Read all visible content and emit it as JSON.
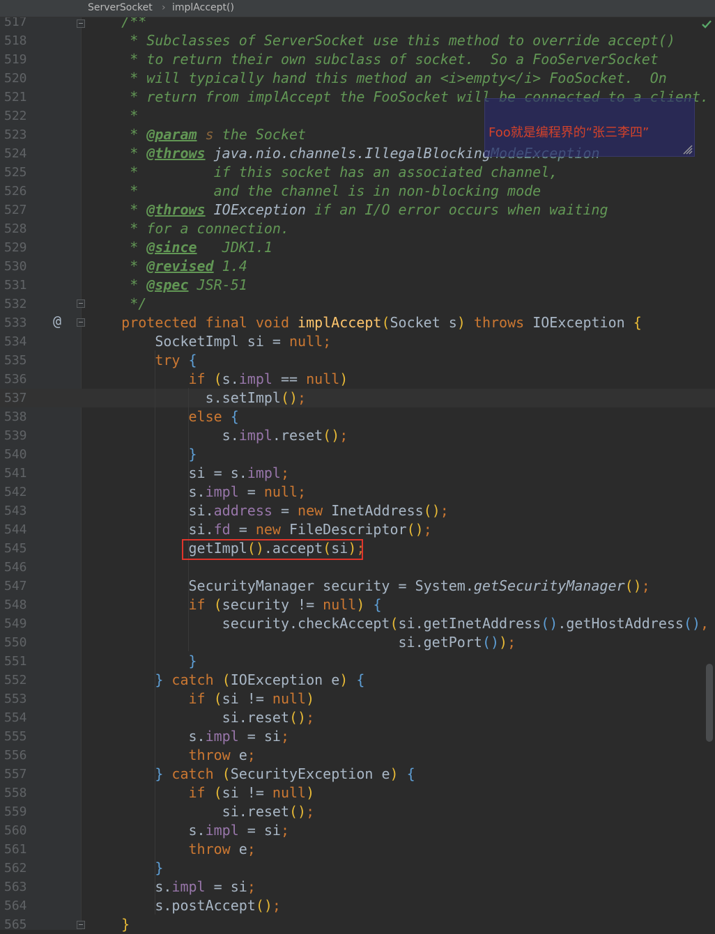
{
  "breadcrumb": {
    "class_name": "ServerSocket",
    "method_name": "implAccept()"
  },
  "note": {
    "text": "Foo就是编程界的“张三李四”"
  },
  "status": {
    "check": "check-icon"
  },
  "lines": [
    {
      "number": "517",
      "segments": [
        [
          "t-doc",
          "    /**"
        ]
      ]
    },
    {
      "number": "518",
      "segments": [
        [
          "t-doc",
          "     * Subclasses of ServerSocket use this method to override accept()"
        ]
      ]
    },
    {
      "number": "519",
      "segments": [
        [
          "t-doc",
          "     * to return their own subclass of socket.  So a FooServerSocket"
        ]
      ]
    },
    {
      "number": "520",
      "segments": [
        [
          "t-doc",
          "     * will typically hand this method an <i>empty</i> FooSocket.  On"
        ]
      ]
    },
    {
      "number": "521",
      "segments": [
        [
          "t-doc",
          "     * return from implAccept the FooSocket will be connected to a client."
        ]
      ]
    },
    {
      "number": "522",
      "segments": [
        [
          "t-doc",
          "     *"
        ]
      ]
    },
    {
      "number": "523",
      "segments": [
        [
          "t-doc",
          "     * "
        ],
        [
          "t-doctag",
          "@param"
        ],
        [
          "t-doc",
          " "
        ],
        [
          "t-docval",
          "s"
        ],
        [
          "t-doc",
          " the Socket"
        ]
      ]
    },
    {
      "number": "524",
      "segments": [
        [
          "t-doc",
          "     * "
        ],
        [
          "t-doctag",
          "@throws"
        ],
        [
          "t-doc",
          " "
        ],
        [
          "t-docref",
          "java.nio.channels.IllegalBlocking"
        ],
        [
          "t-dim",
          "ModeException"
        ]
      ]
    },
    {
      "number": "525",
      "segments": [
        [
          "t-doc",
          "     *         if this socket has an associated channel,"
        ]
      ]
    },
    {
      "number": "526",
      "segments": [
        [
          "t-doc",
          "     *         and the channel is in non-blocking mode"
        ]
      ]
    },
    {
      "number": "527",
      "segments": [
        [
          "t-doc",
          "     * "
        ],
        [
          "t-doctag",
          "@throws"
        ],
        [
          "t-doc",
          " "
        ],
        [
          "t-docref",
          "IOException"
        ],
        [
          "t-doc",
          " if an I/O error occurs when waiting"
        ]
      ]
    },
    {
      "number": "528",
      "segments": [
        [
          "t-doc",
          "     * for a connection."
        ]
      ]
    },
    {
      "number": "529",
      "segments": [
        [
          "t-doc",
          "     * "
        ],
        [
          "t-doctag",
          "@since"
        ],
        [
          "t-doc",
          "   JDK1.1"
        ]
      ]
    },
    {
      "number": "530",
      "segments": [
        [
          "t-doc",
          "     * "
        ],
        [
          "t-doctag",
          "@revised"
        ],
        [
          "t-doc",
          " 1.4"
        ]
      ]
    },
    {
      "number": "531",
      "segments": [
        [
          "t-doc",
          "     * "
        ],
        [
          "t-doctag",
          "@spec"
        ],
        [
          "t-doc",
          " JSR-51"
        ]
      ]
    },
    {
      "number": "532",
      "segments": [
        [
          "t-doc",
          "     */"
        ]
      ]
    },
    {
      "number": "533",
      "segments": [
        [
          "t-kw",
          "    protected final void "
        ],
        [
          "t-fn",
          "implAccept"
        ],
        [
          "t-p1",
          "("
        ],
        [
          "t-plain",
          "Socket s"
        ],
        [
          "t-p1",
          ")"
        ],
        [
          "t-kw",
          " throws "
        ],
        [
          "t-plain",
          "IOException "
        ],
        [
          "t-p1",
          "{"
        ]
      ]
    },
    {
      "number": "534",
      "segments": [
        [
          "t-plain",
          "        SocketImpl si = "
        ],
        [
          "t-kw",
          "null"
        ],
        [
          "t-kw",
          ";"
        ]
      ]
    },
    {
      "number": "535",
      "segments": [
        [
          "t-kw",
          "        try "
        ],
        [
          "t-p2",
          "{"
        ]
      ]
    },
    {
      "number": "536",
      "segments": [
        [
          "t-kw",
          "            if "
        ],
        [
          "t-p1",
          "("
        ],
        [
          "t-plain",
          "s."
        ],
        [
          "t-field",
          "impl"
        ],
        [
          "t-plain",
          " == "
        ],
        [
          "t-kw",
          "null"
        ],
        [
          "t-p1",
          ")"
        ]
      ]
    },
    {
      "number": "537",
      "segments": [
        [
          "t-plain",
          "              s.setImpl"
        ],
        [
          "t-p1",
          "()"
        ],
        [
          "t-kw",
          ";"
        ]
      ]
    },
    {
      "number": "538",
      "segments": [
        [
          "t-kw",
          "            else "
        ],
        [
          "t-p2",
          "{"
        ]
      ]
    },
    {
      "number": "539",
      "segments": [
        [
          "t-plain",
          "                s."
        ],
        [
          "t-field",
          "impl"
        ],
        [
          "t-plain",
          ".reset"
        ],
        [
          "t-p1",
          "()"
        ],
        [
          "t-kw",
          ";"
        ]
      ]
    },
    {
      "number": "540",
      "segments": [
        [
          "t-p2",
          "            }"
        ]
      ]
    },
    {
      "number": "541",
      "segments": [
        [
          "t-plain",
          "            si = s."
        ],
        [
          "t-field",
          "impl"
        ],
        [
          "t-kw",
          ";"
        ]
      ]
    },
    {
      "number": "542",
      "segments": [
        [
          "t-plain",
          "            s."
        ],
        [
          "t-field",
          "impl"
        ],
        [
          "t-plain",
          " = "
        ],
        [
          "t-kw",
          "null;"
        ]
      ]
    },
    {
      "number": "543",
      "segments": [
        [
          "t-plain",
          "            si."
        ],
        [
          "t-field",
          "address"
        ],
        [
          "t-plain",
          " = "
        ],
        [
          "t-kw",
          "new "
        ],
        [
          "t-plain",
          "InetAddress"
        ],
        [
          "t-p1",
          "()"
        ],
        [
          "t-kw",
          ";"
        ]
      ]
    },
    {
      "number": "544",
      "segments": [
        [
          "t-plain",
          "            si."
        ],
        [
          "t-field",
          "fd"
        ],
        [
          "t-plain",
          " = "
        ],
        [
          "t-kw",
          "new "
        ],
        [
          "t-plain",
          "FileDescriptor"
        ],
        [
          "t-p1",
          "()"
        ],
        [
          "t-kw",
          ";"
        ]
      ]
    },
    {
      "number": "545",
      "segments": [
        [
          "t-plain",
          "            getImpl"
        ],
        [
          "t-p1",
          "()"
        ],
        [
          "t-plain",
          ".accept"
        ],
        [
          "t-p1",
          "("
        ],
        [
          "t-plain",
          "si"
        ],
        [
          "t-p1",
          ")"
        ],
        [
          "t-kw",
          ";"
        ]
      ]
    },
    {
      "number": "546",
      "segments": [
        [
          "t-plain",
          ""
        ]
      ]
    },
    {
      "number": "547",
      "segments": [
        [
          "t-plain",
          "            SecurityManager security = System."
        ],
        [
          "t-static",
          "getSecurityManager"
        ],
        [
          "t-p1",
          "()"
        ],
        [
          "t-kw",
          ";"
        ]
      ]
    },
    {
      "number": "548",
      "segments": [
        [
          "t-kw",
          "            if "
        ],
        [
          "t-p1",
          "("
        ],
        [
          "t-plain",
          "security != "
        ],
        [
          "t-kw",
          "null"
        ],
        [
          "t-p1",
          ")"
        ],
        [
          "t-plain",
          " "
        ],
        [
          "t-p2",
          "{"
        ]
      ]
    },
    {
      "number": "549",
      "segments": [
        [
          "t-plain",
          "                security.checkAccept"
        ],
        [
          "t-p1",
          "("
        ],
        [
          "t-plain",
          "si.getInetAddress"
        ],
        [
          "t-p2",
          "()"
        ],
        [
          "t-plain",
          ".getHostAddress"
        ],
        [
          "t-p2",
          "()"
        ],
        [
          "t-kw",
          ","
        ]
      ]
    },
    {
      "number": "550",
      "segments": [
        [
          "t-plain",
          "                                     si.getPort"
        ],
        [
          "t-p2",
          "()"
        ],
        [
          "t-p1",
          ")"
        ],
        [
          "t-kw",
          ";"
        ]
      ]
    },
    {
      "number": "551",
      "segments": [
        [
          "t-p2",
          "            }"
        ]
      ]
    },
    {
      "number": "552",
      "segments": [
        [
          "t-p2",
          "        }"
        ],
        [
          "t-kw",
          " catch "
        ],
        [
          "t-p1",
          "("
        ],
        [
          "t-plain",
          "IOException e"
        ],
        [
          "t-p1",
          ")"
        ],
        [
          "t-plain",
          " "
        ],
        [
          "t-p2",
          "{"
        ]
      ]
    },
    {
      "number": "553",
      "segments": [
        [
          "t-kw",
          "            if "
        ],
        [
          "t-p1",
          "("
        ],
        [
          "t-plain",
          "si != "
        ],
        [
          "t-kw",
          "null"
        ],
        [
          "t-p1",
          ")"
        ]
      ]
    },
    {
      "number": "554",
      "segments": [
        [
          "t-plain",
          "                si.reset"
        ],
        [
          "t-p1",
          "()"
        ],
        [
          "t-kw",
          ";"
        ]
      ]
    },
    {
      "number": "555",
      "segments": [
        [
          "t-plain",
          "            s."
        ],
        [
          "t-field",
          "impl"
        ],
        [
          "t-plain",
          " = si"
        ],
        [
          "t-kw",
          ";"
        ]
      ]
    },
    {
      "number": "556",
      "segments": [
        [
          "t-kw",
          "            throw "
        ],
        [
          "t-plain",
          "e"
        ],
        [
          "t-kw",
          ";"
        ]
      ]
    },
    {
      "number": "557",
      "segments": [
        [
          "t-p2",
          "        }"
        ],
        [
          "t-kw",
          " catch "
        ],
        [
          "t-p1",
          "("
        ],
        [
          "t-plain",
          "SecurityException e"
        ],
        [
          "t-p1",
          ")"
        ],
        [
          "t-plain",
          " "
        ],
        [
          "t-p2",
          "{"
        ]
      ]
    },
    {
      "number": "558",
      "segments": [
        [
          "t-kw",
          "            if "
        ],
        [
          "t-p1",
          "("
        ],
        [
          "t-plain",
          "si != "
        ],
        [
          "t-kw",
          "null"
        ],
        [
          "t-p1",
          ")"
        ]
      ]
    },
    {
      "number": "559",
      "segments": [
        [
          "t-plain",
          "                si.reset"
        ],
        [
          "t-p1",
          "()"
        ],
        [
          "t-kw",
          ";"
        ]
      ]
    },
    {
      "number": "560",
      "segments": [
        [
          "t-plain",
          "            s."
        ],
        [
          "t-field",
          "impl"
        ],
        [
          "t-plain",
          " = si"
        ],
        [
          "t-kw",
          ";"
        ]
      ]
    },
    {
      "number": "561",
      "segments": [
        [
          "t-kw",
          "            throw "
        ],
        [
          "t-plain",
          "e"
        ],
        [
          "t-kw",
          ";"
        ]
      ]
    },
    {
      "number": "562",
      "segments": [
        [
          "t-p2",
          "        }"
        ]
      ]
    },
    {
      "number": "563",
      "segments": [
        [
          "t-plain",
          "        s."
        ],
        [
          "t-field",
          "impl"
        ],
        [
          "t-plain",
          " = si"
        ],
        [
          "t-kw",
          ";"
        ]
      ]
    },
    {
      "number": "564",
      "segments": [
        [
          "t-plain",
          "        s.postAccept"
        ],
        [
          "t-p1",
          "()"
        ],
        [
          "t-kw",
          ";"
        ]
      ]
    },
    {
      "number": "565",
      "segments": [
        [
          "t-p1",
          "    }"
        ]
      ]
    }
  ]
}
